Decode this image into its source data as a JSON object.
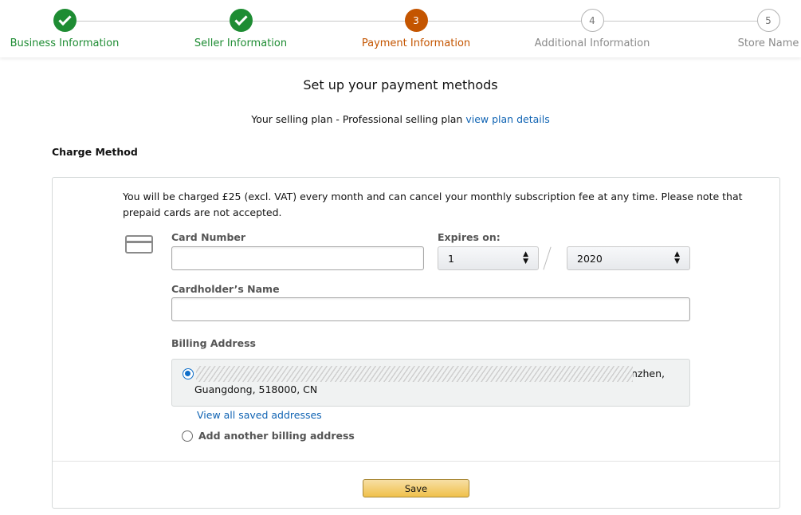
{
  "stepper": {
    "steps": [
      {
        "number": "1",
        "label": "Business Information",
        "status": "done"
      },
      {
        "number": "2",
        "label": "Seller Information",
        "status": "done"
      },
      {
        "number": "3",
        "label": "Payment Information",
        "status": "active"
      },
      {
        "number": "4",
        "label": "Additional Information",
        "status": "todo"
      },
      {
        "number": "5",
        "label": "Store Name",
        "status": "todo"
      }
    ],
    "colors": {
      "done": "#1e8c33",
      "active": "#c45500",
      "todo": "#8a8a8a"
    }
  },
  "page": {
    "title": "Set up your payment methods",
    "plan_text": "Your selling plan - Professional selling plan",
    "plan_link": "view plan details",
    "section_title": "Charge Method"
  },
  "payment": {
    "notice": "You will be charged £25 (excl. VAT) every month and can cancel your monthly subscription fee at any time. Please note that prepaid cards are not accepted.",
    "card_number_label": "Card Number",
    "card_number_value": "",
    "expires_label": "Expires on:",
    "expiry_month": "1",
    "expiry_year": "2020",
    "cardholder_label": "Cardholder’s Name",
    "cardholder_value": "",
    "billing_label": "Billing Address",
    "saved_address_line1_visible": "enzhen,",
    "saved_address_line2": "Guangdong, 518000, CN",
    "view_saved_link": "View all saved addresses",
    "add_another_label": "Add another billing address",
    "save_label": "Save"
  }
}
